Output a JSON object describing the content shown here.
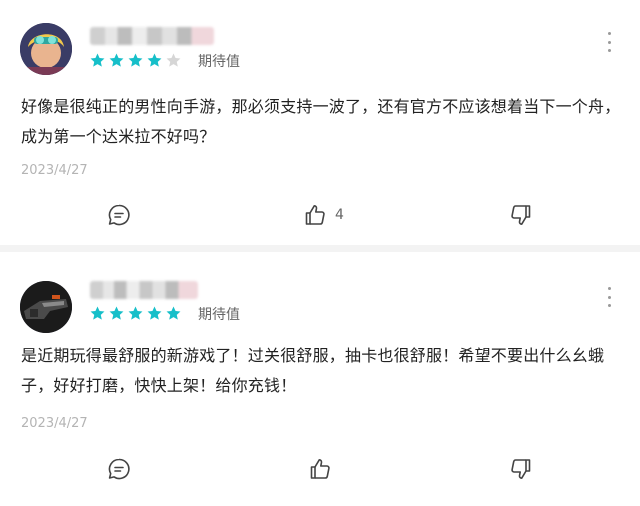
{
  "reviews": [
    {
      "rating": 4,
      "rating_max": 5,
      "rating_label": "期待值",
      "content": "好像是很纯正的男性向手游，那必须支持一波了，还有官方不应该想着当下一个舟，成为第一个达米拉不好吗？",
      "date": "2023/4/27",
      "like_count": "4",
      "icons": {
        "comment": "comment-icon",
        "like": "thumb-up-icon",
        "dislike": "thumb-down-icon",
        "more": "more-vertical-icon"
      }
    },
    {
      "rating": 5,
      "rating_max": 5,
      "rating_label": "期待值",
      "content": "是近期玩得最舒服的新游戏了！过关很舒服，抽卡也很舒服！希望不要出什么幺蛾子，好好打磨，快快上架！给你充钱！",
      "date": "2023/4/27",
      "like_count": "",
      "icons": {
        "comment": "comment-icon",
        "like": "thumb-up-icon",
        "dislike": "thumb-down-icon",
        "more": "more-vertical-icon"
      }
    }
  ],
  "colors": {
    "star_on": "#16bfc9",
    "star_off": "#d6d6d6",
    "date": "#b4b4b4",
    "divider": "#f3f3f3"
  }
}
